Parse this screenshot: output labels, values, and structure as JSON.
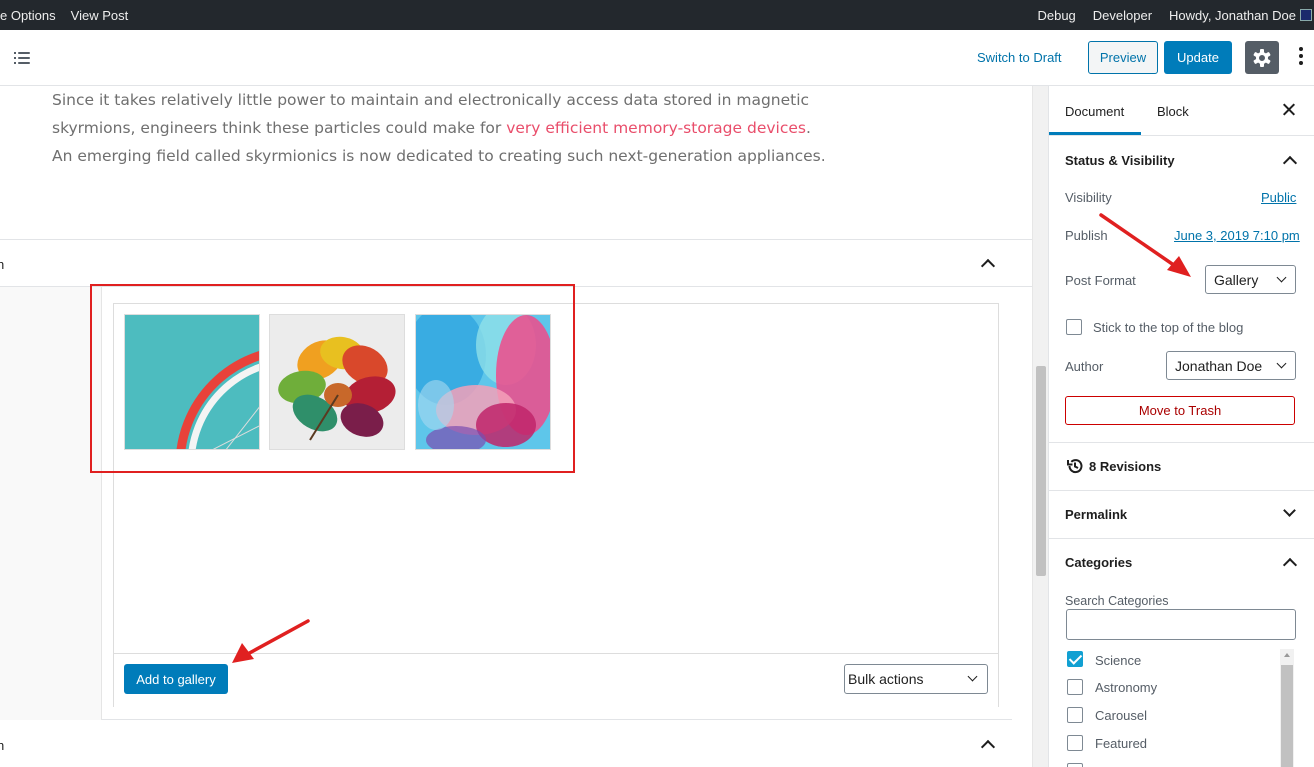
{
  "adminbar": {
    "left_items": [
      "e Options",
      "View Post"
    ],
    "right_items": [
      "Debug",
      "Developer",
      "Howdy, Jonathan Doe"
    ]
  },
  "header": {
    "switch_to_draft": "Switch to Draft",
    "preview": "Preview",
    "update": "Update"
  },
  "content": {
    "paragraph_before": "Since it takes relatively little power to maintain and electronically access data stored in magnetic skyrmions, engineers think these particles could make for ",
    "paragraph_link": "very efficient memory-storage devices",
    "paragraph_after": ". An emerging field called skyrmionics is now dedicated to creating such next-generation appliances.",
    "metabox_label": "n",
    "metabox2_label": "n",
    "add_to_gallery": "Add to gallery",
    "bulk_actions": "Bulk actions"
  },
  "sidebar": {
    "tab_document": "Document",
    "tab_block": "Block",
    "status_title": "Status & Visibility",
    "visibility_label": "Visibility",
    "visibility_value": "Public",
    "publish_label": "Publish",
    "publish_value": "June 3, 2019 7:10 pm",
    "post_format_label": "Post Format",
    "post_format_value": "Gallery",
    "sticky_label": "Stick to the top of the blog",
    "author_label": "Author",
    "author_value": "Jonathan Doe",
    "trash": "Move to Trash",
    "revisions": "8 Revisions",
    "permalink": "Permalink",
    "categories": "Categories",
    "search_categories": "Search Categories",
    "category_items": [
      {
        "label": "Science",
        "checked": true
      },
      {
        "label": "Astronomy",
        "checked": false
      },
      {
        "label": "Carousel",
        "checked": false
      },
      {
        "label": "Featured",
        "checked": false
      }
    ]
  },
  "colors": {
    "primary": "#007cba",
    "link": "#0073aa",
    "annotation_red": "#e02020",
    "content_link": "#e94e6b",
    "trash_red": "#a00"
  }
}
